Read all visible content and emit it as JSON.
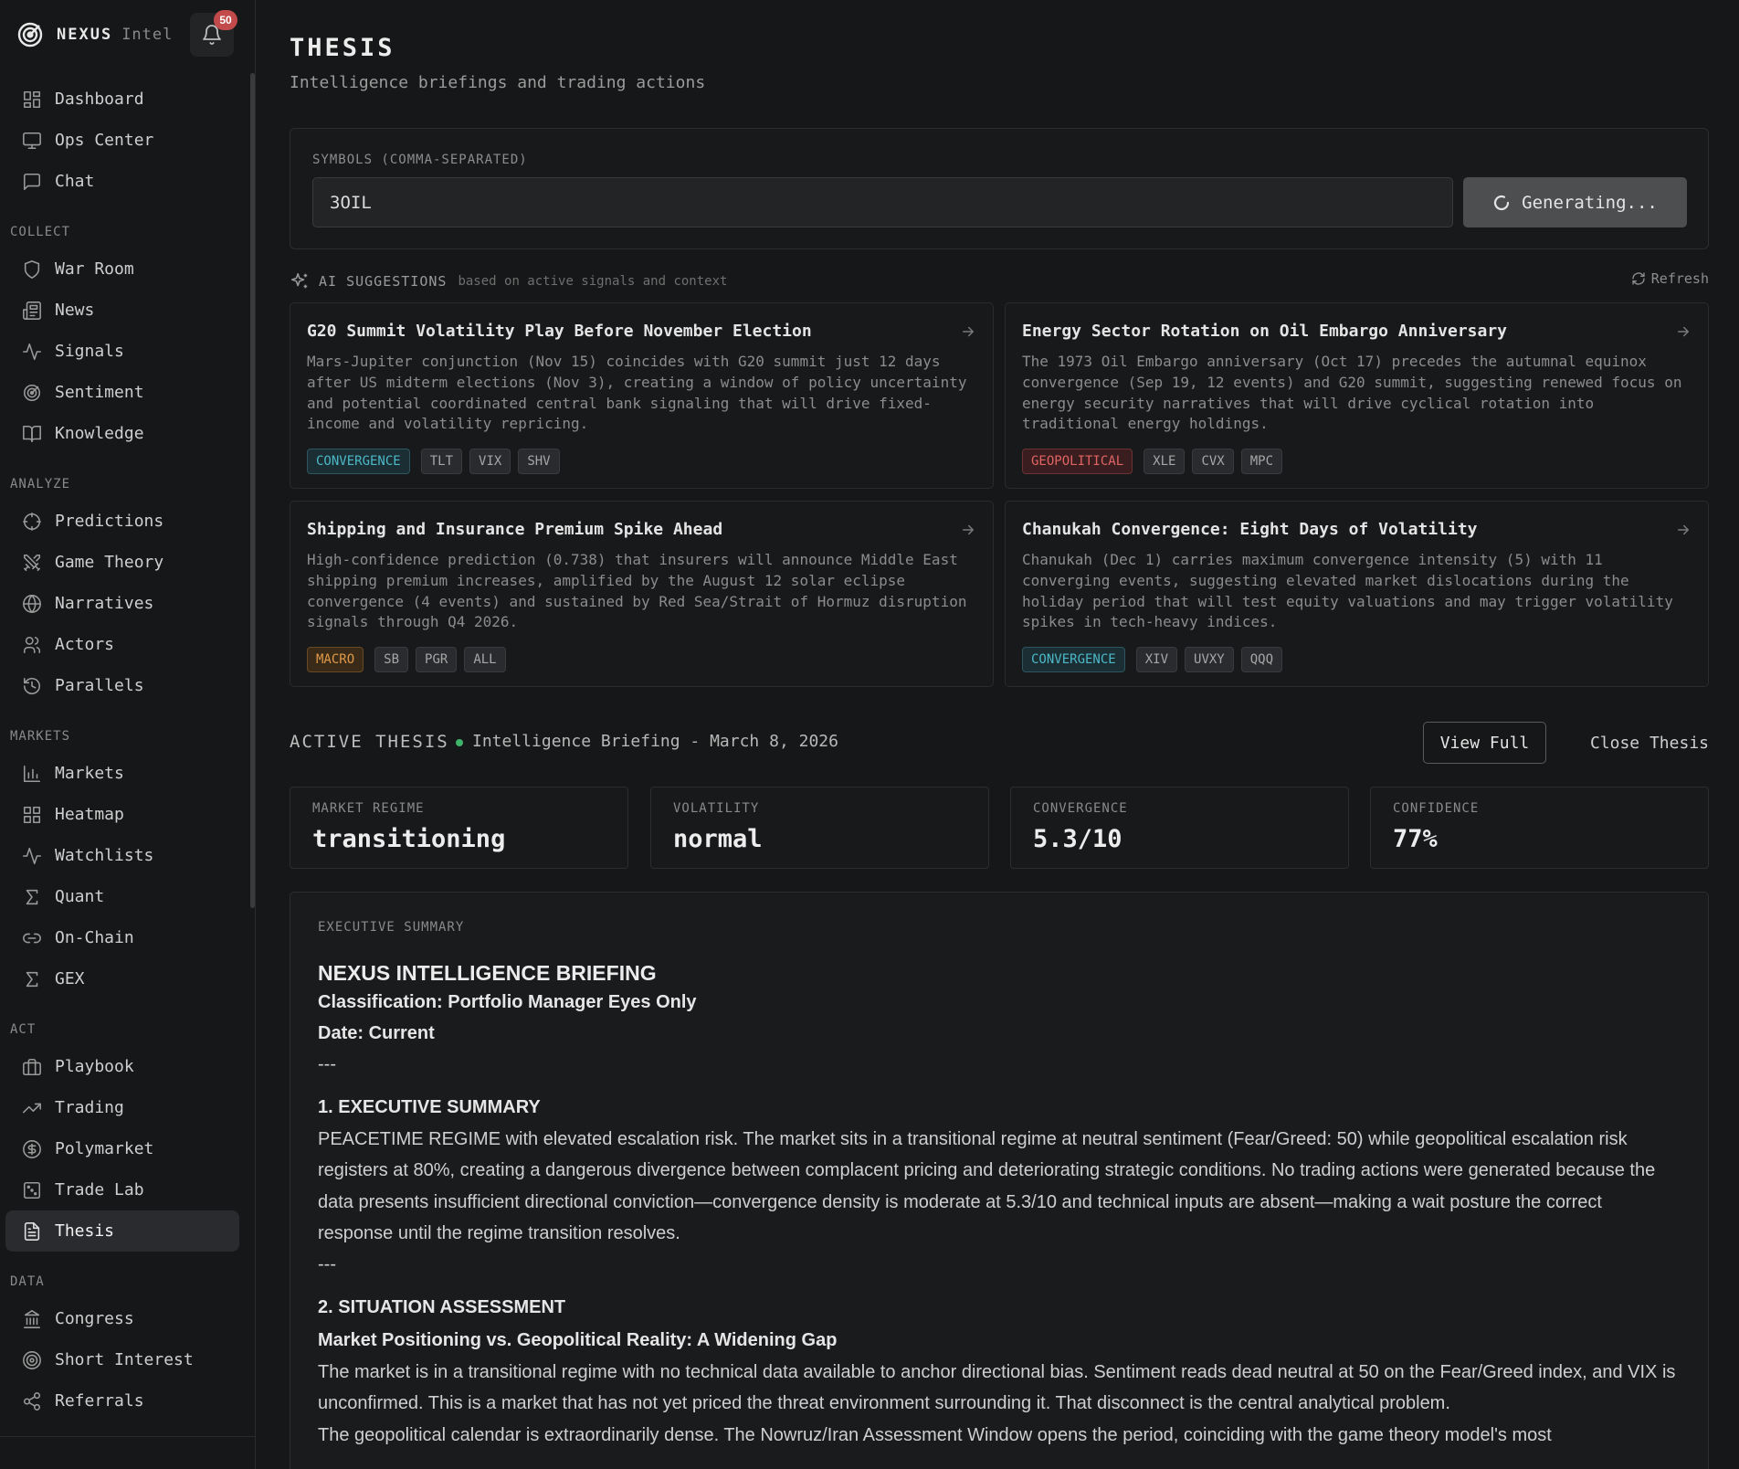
{
  "brand": {
    "name": "NEXUS",
    "sub": "Intel",
    "notifications": "50"
  },
  "nav": {
    "top": [
      {
        "label": "Dashboard",
        "icon": "dashboard-icon"
      },
      {
        "label": "Ops Center",
        "icon": "monitor-icon"
      },
      {
        "label": "Chat",
        "icon": "chat-icon"
      }
    ],
    "sections": [
      {
        "title": "COLLECT",
        "items": [
          {
            "label": "War Room",
            "icon": "shield-icon"
          },
          {
            "label": "News",
            "icon": "newspaper-icon"
          },
          {
            "label": "Signals",
            "icon": "pulse-icon"
          },
          {
            "label": "Sentiment",
            "icon": "radar-icon"
          },
          {
            "label": "Knowledge",
            "icon": "book-icon"
          }
        ]
      },
      {
        "title": "ANALYZE",
        "items": [
          {
            "label": "Predictions",
            "icon": "crosshair-icon"
          },
          {
            "label": "Game Theory",
            "icon": "swords-icon"
          },
          {
            "label": "Narratives",
            "icon": "globe-icon"
          },
          {
            "label": "Actors",
            "icon": "users-icon"
          },
          {
            "label": "Parallels",
            "icon": "history-icon"
          }
        ]
      },
      {
        "title": "MARKETS",
        "items": [
          {
            "label": "Markets",
            "icon": "bar-chart-icon"
          },
          {
            "label": "Heatmap",
            "icon": "grid-icon"
          },
          {
            "label": "Watchlists",
            "icon": "pulse-icon"
          },
          {
            "label": "Quant",
            "icon": "sigma-icon"
          },
          {
            "label": "On-Chain",
            "icon": "link-icon"
          },
          {
            "label": "GEX",
            "icon": "sigma-icon"
          }
        ]
      },
      {
        "title": "ACT",
        "items": [
          {
            "label": "Playbook",
            "icon": "briefcase-icon"
          },
          {
            "label": "Trading",
            "icon": "trend-up-icon"
          },
          {
            "label": "Polymarket",
            "icon": "dollar-circle-icon"
          },
          {
            "label": "Trade Lab",
            "icon": "dice-icon"
          },
          {
            "label": "Thesis",
            "icon": "document-icon",
            "active": true
          }
        ]
      },
      {
        "title": "DATA",
        "items": [
          {
            "label": "Congress",
            "icon": "landmark-icon"
          },
          {
            "label": "Short Interest",
            "icon": "target-icon"
          },
          {
            "label": "Referrals",
            "icon": "share-icon"
          }
        ]
      }
    ]
  },
  "page": {
    "title": "THESIS",
    "subtitle": "Intelligence briefings and trading actions"
  },
  "symbols": {
    "label": "SYMBOLS (COMMA-SEPARATED)",
    "value": "3OIL",
    "button_label": "Generating..."
  },
  "ai": {
    "label": "AI SUGGESTIONS",
    "hint": "based on active signals and context",
    "refresh_label": "Refresh"
  },
  "suggestions": [
    {
      "title": "G20 Summit Volatility Play Before November Election",
      "body": "Mars-Jupiter conjunction (Nov 15) coincides with G20 summit just 12 days after US midterm elections (Nov 3), creating a window of policy uncertainty and potential coordinated central bank signaling that will drive fixed-income and volatility repricing.",
      "kind": "CONVERGENCE",
      "kind_color": "#4cb8c8",
      "kind_bg": "#1b2e33",
      "kind_border": "#2d5660",
      "tickers": [
        "TLT",
        "VIX",
        "SHV"
      ]
    },
    {
      "title": "Energy Sector Rotation on Oil Embargo Anniversary",
      "body": "The 1973 Oil Embargo anniversary (Oct 17) precedes the autumnal equinox convergence (Sep 19, 12 events) and G20 summit, suggesting renewed focus on energy security narratives that will drive cyclical rotation into traditional energy holdings.",
      "kind": "GEOPOLITICAL",
      "kind_color": "#e06464",
      "kind_bg": "#3a1e1f",
      "kind_border": "#6a3234",
      "tickers": [
        "XLE",
        "CVX",
        "MPC"
      ]
    },
    {
      "title": "Shipping and Insurance Premium Spike Ahead",
      "body": "High-confidence prediction (0.738) that insurers will announce Middle East shipping premium increases, amplified by the August 12 solar eclipse convergence (4 events) and sustained by Red Sea/Strait of Hormuz disruption signals through Q4 2026.",
      "kind": "MACRO",
      "kind_color": "#e09a4a",
      "kind_bg": "#3a2a18",
      "kind_border": "#6a4a24",
      "tickers": [
        "SB",
        "PGR",
        "ALL"
      ]
    },
    {
      "title": "Chanukah Convergence: Eight Days of Volatility",
      "body": "Chanukah (Dec 1) carries maximum convergence intensity (5) with 11 converging events, suggesting elevated market dislocations during the holiday period that will test equity valuations and may trigger volatility spikes in tech-heavy indices.",
      "kind": "CONVERGENCE",
      "kind_color": "#4cb8c8",
      "kind_bg": "#1b2e33",
      "kind_border": "#2d5660",
      "tickers": [
        "XIV",
        "UVXY",
        "QQQ"
      ]
    }
  ],
  "thesis": {
    "label": "ACTIVE THESIS",
    "name": "Intelligence Briefing - March 8, 2026",
    "view_full": "View Full",
    "close": "Close Thesis",
    "status_color": "#3fb56a"
  },
  "metrics": [
    {
      "label": "MARKET REGIME",
      "value": "transitioning"
    },
    {
      "label": "VOLATILITY",
      "value": "normal"
    },
    {
      "label": "CONVERGENCE",
      "value": "5.3/10"
    },
    {
      "label": "CONFIDENCE",
      "value": "77%"
    }
  ],
  "briefing": {
    "label": "EXECUTIVE SUMMARY",
    "heading": "NEXUS INTELLIGENCE BRIEFING",
    "classification": "Classification: Portfolio Manager Eyes Only",
    "date": "Date: Current",
    "rule": "---",
    "section1_title": "1. EXECUTIVE SUMMARY",
    "section1_body": "PEACETIME REGIME with elevated escalation risk. The market sits in a transitional regime at neutral sentiment (Fear/Greed: 50) while geopolitical escalation risk registers at 80%, creating a dangerous divergence between complacent pricing and deteriorating strategic conditions. No trading actions were generated because the data presents insufficient directional conviction—convergence density is moderate at 5.3/10 and technical inputs are absent—making a wait posture the correct response until the regime transition resolves.",
    "section2_title": "2. SITUATION ASSESSMENT",
    "section2_sub": "Market Positioning vs. Geopolitical Reality: A Widening Gap",
    "section2_p1": "The market is in a transitional regime with no technical data available to anchor directional bias. Sentiment reads dead neutral at 50 on the Fear/Greed index, and VIX is unconfirmed. This is a market that has not yet priced the threat environment surrounding it. That disconnect is the central analytical problem.",
    "section2_p2": "The geopolitical calendar is extraordinarily dense. The Nowruz/Iran Assessment Window opens the period, coinciding with the game theory model's most"
  }
}
